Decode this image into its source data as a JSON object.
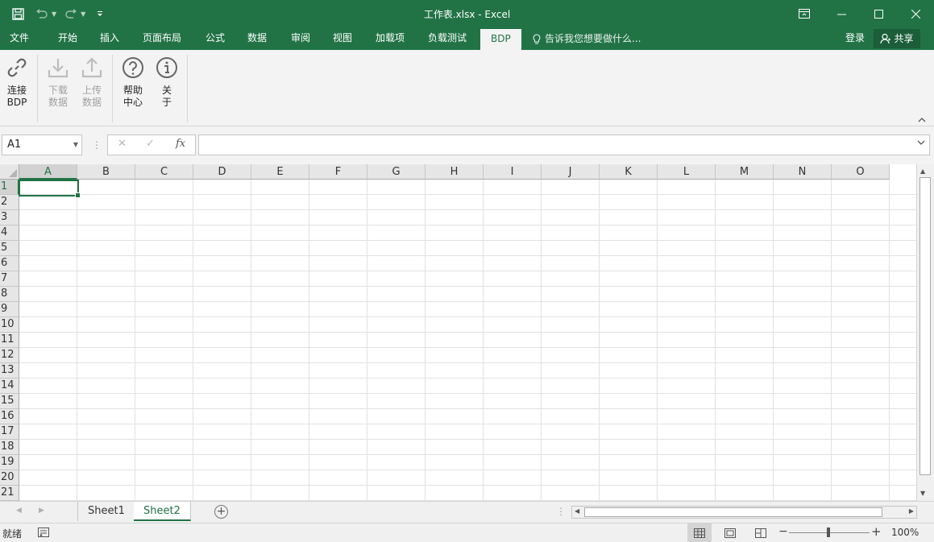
{
  "window": {
    "title": "工作表.xlsx - Excel"
  },
  "ribbon_tabs": [
    {
      "label": "文件",
      "active": false
    },
    {
      "label": "开始",
      "active": false
    },
    {
      "label": "插入",
      "active": false
    },
    {
      "label": "页面布局",
      "active": false
    },
    {
      "label": "公式",
      "active": false
    },
    {
      "label": "数据",
      "active": false
    },
    {
      "label": "审阅",
      "active": false
    },
    {
      "label": "视图",
      "active": false
    },
    {
      "label": "加载项",
      "active": false
    },
    {
      "label": "负载测试",
      "active": false
    },
    {
      "label": "BDP",
      "active": true
    }
  ],
  "tell_me": "告诉我您想要做什么...",
  "account": {
    "login": "登录",
    "share": "共享"
  },
  "ribbon_buttons": {
    "connect": {
      "line1": "连接",
      "line2": "BDP",
      "enabled": true
    },
    "download": {
      "line1": "下载",
      "line2": "数据",
      "enabled": false
    },
    "upload": {
      "line1": "上传",
      "line2": "数据",
      "enabled": false
    },
    "help": {
      "line1": "帮助",
      "line2": "中心",
      "enabled": true
    },
    "about": {
      "line1": "关",
      "line2": "于",
      "enabled": true
    }
  },
  "formula_bar": {
    "name_box": "A1",
    "fx": "fx",
    "value": ""
  },
  "grid": {
    "columns": [
      "A",
      "B",
      "C",
      "D",
      "E",
      "F",
      "G",
      "H",
      "I",
      "J",
      "K",
      "L",
      "M",
      "N",
      "O"
    ],
    "rows": [
      "1",
      "2",
      "3",
      "4",
      "5",
      "6",
      "7",
      "8",
      "9",
      "10",
      "11",
      "12",
      "13",
      "14",
      "15",
      "16",
      "17",
      "18",
      "19",
      "20",
      "21"
    ],
    "active_cell": "A1"
  },
  "sheets": [
    {
      "label": "Sheet1",
      "active": false
    },
    {
      "label": "Sheet2",
      "active": true
    }
  ],
  "status": {
    "ready": "就绪",
    "zoom": "100%"
  },
  "colors": {
    "accent": "#217346",
    "ribbon_bg": "#f3f3f3"
  }
}
